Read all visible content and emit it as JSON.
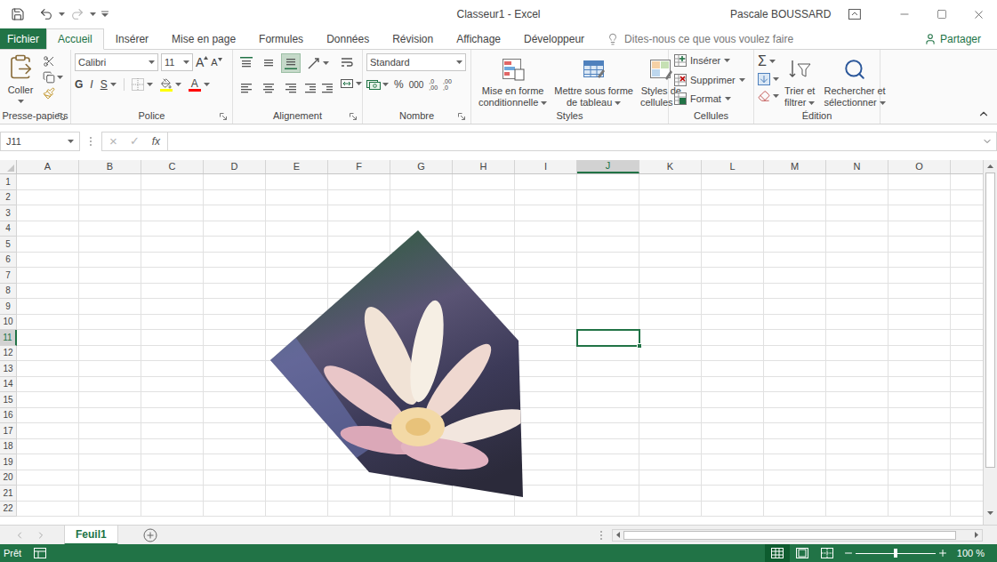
{
  "window": {
    "title": "Classeur1 - Excel",
    "user": "Pascale BOUSSARD"
  },
  "ribbon_tabs": [
    {
      "label": "Fichier",
      "selected": false,
      "kind": "file"
    },
    {
      "label": "Accueil",
      "selected": true,
      "kind": "tab"
    },
    {
      "label": "Insérer",
      "selected": false,
      "kind": "tab"
    },
    {
      "label": "Mise en page",
      "selected": false,
      "kind": "tab"
    },
    {
      "label": "Formules",
      "selected": false,
      "kind": "tab"
    },
    {
      "label": "Données",
      "selected": false,
      "kind": "tab"
    },
    {
      "label": "Révision",
      "selected": false,
      "kind": "tab"
    },
    {
      "label": "Affichage",
      "selected": false,
      "kind": "tab"
    },
    {
      "label": "Développeur",
      "selected": false,
      "kind": "tab"
    }
  ],
  "tell_me": {
    "placeholder": "Dites-nous ce que vous voulez faire"
  },
  "share": "Partager",
  "clipboard": {
    "group": "Presse-papiers",
    "paste": "Coller"
  },
  "font": {
    "group": "Police",
    "name": "Calibri",
    "size": "11",
    "grow": "A",
    "shrink": "A",
    "bold": "G",
    "italic": "I",
    "underline": "S",
    "color": "A"
  },
  "alignment": {
    "group": "Alignement",
    "vertical": [
      {
        "selected": false
      },
      {
        "selected": false
      },
      {
        "selected": true
      }
    ],
    "horizontal": [
      {
        "selected": false
      },
      {
        "selected": false
      },
      {
        "selected": false
      }
    ]
  },
  "number": {
    "group": "Nombre",
    "format": "Standard",
    "percent": "%",
    "thousands": "000",
    "increase_decimal": [
      ",0",
      ",00"
    ],
    "decrease_decimal": [
      ",00",
      ",0"
    ]
  },
  "styles": {
    "group": "Styles",
    "buttons": [
      {
        "lines": [
          "Mise en forme",
          "conditionnelle"
        ]
      },
      {
        "lines": [
          "Mettre sous forme",
          "de tableau"
        ]
      },
      {
        "lines": [
          "Styles de",
          "cellules"
        ]
      }
    ]
  },
  "cells": {
    "group": "Cellules",
    "buttons": [
      "Insérer",
      "Supprimer",
      "Format"
    ]
  },
  "editing": {
    "group": "Édition",
    "sum": "Σ",
    "buttons": [
      {
        "lines": [
          "Trier et",
          "filtrer"
        ]
      },
      {
        "lines": [
          "Rechercher et",
          "sélectionner"
        ]
      }
    ]
  },
  "formula_bar": {
    "name_box": "J11",
    "cancel": "×",
    "enter": "✓",
    "fx": "fx",
    "value": ""
  },
  "sheet": {
    "columns": [
      "A",
      "B",
      "C",
      "D",
      "E",
      "F",
      "G",
      "H",
      "I",
      "J",
      "K",
      "L",
      "M",
      "N",
      "O"
    ],
    "rows": [
      "1",
      "2",
      "3",
      "4",
      "5",
      "6",
      "7",
      "8",
      "9",
      "10",
      "11",
      "12",
      "13",
      "14",
      "15",
      "16",
      "17",
      "18",
      "19",
      "20",
      "21",
      "22"
    ],
    "selected_cell": {
      "column": "J",
      "row": "11"
    }
  },
  "sheet_tabs": [
    {
      "label": "Feuil1",
      "selected": true
    }
  ],
  "status_bar": {
    "ready": "Prêt",
    "views": [
      {
        "selected": true
      },
      {
        "selected": false
      },
      {
        "selected": false
      }
    ],
    "zoom": "100 %",
    "zoom_level": 0.5
  }
}
